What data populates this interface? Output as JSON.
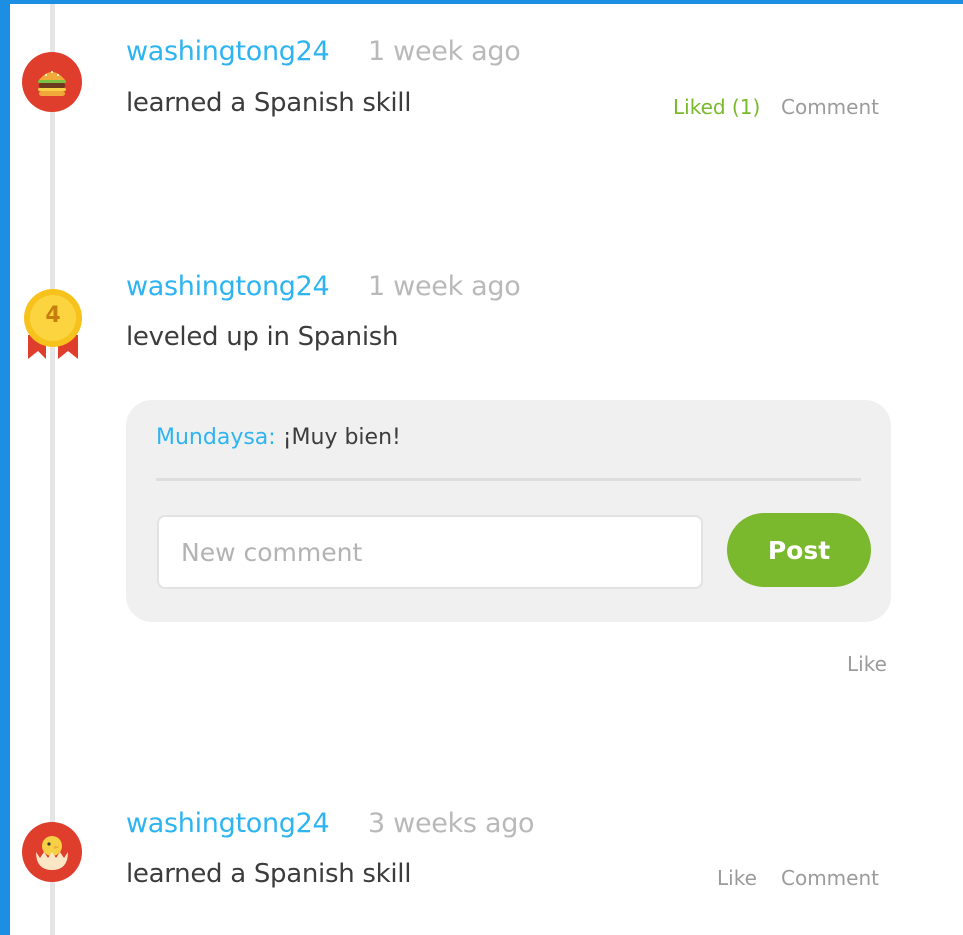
{
  "colors": {
    "frame_blue": "#1c8fe3",
    "username_blue": "#2eb4f0",
    "liked_green": "#7ab82d",
    "post_green": "#7ab82d",
    "avatar_red": "#e03e2d",
    "level_gold": "#f7c21c"
  },
  "feed": [
    {
      "username": "washingtong24",
      "time_ago": "1 week ago",
      "activity": "learned a Spanish skill",
      "icon": "burger-icon",
      "actions": {
        "like": "Liked (1)",
        "comment": "Comment"
      }
    },
    {
      "username": "washingtong24",
      "time_ago": "1 week ago",
      "activity": "leveled up in Spanish",
      "icon": "level-medal-icon",
      "level": "4",
      "comments": [
        {
          "author": "Mundaysa:",
          "text": "¡Muy bien!"
        }
      ],
      "new_comment_placeholder": "New comment",
      "post_label": "Post",
      "actions": {
        "like": "Like"
      }
    },
    {
      "username": "washingtong24",
      "time_ago": "3 weeks ago",
      "activity": "learned a Spanish skill",
      "icon": "hatching-chick-icon",
      "actions": {
        "like": "Like",
        "comment": "Comment"
      }
    }
  ]
}
